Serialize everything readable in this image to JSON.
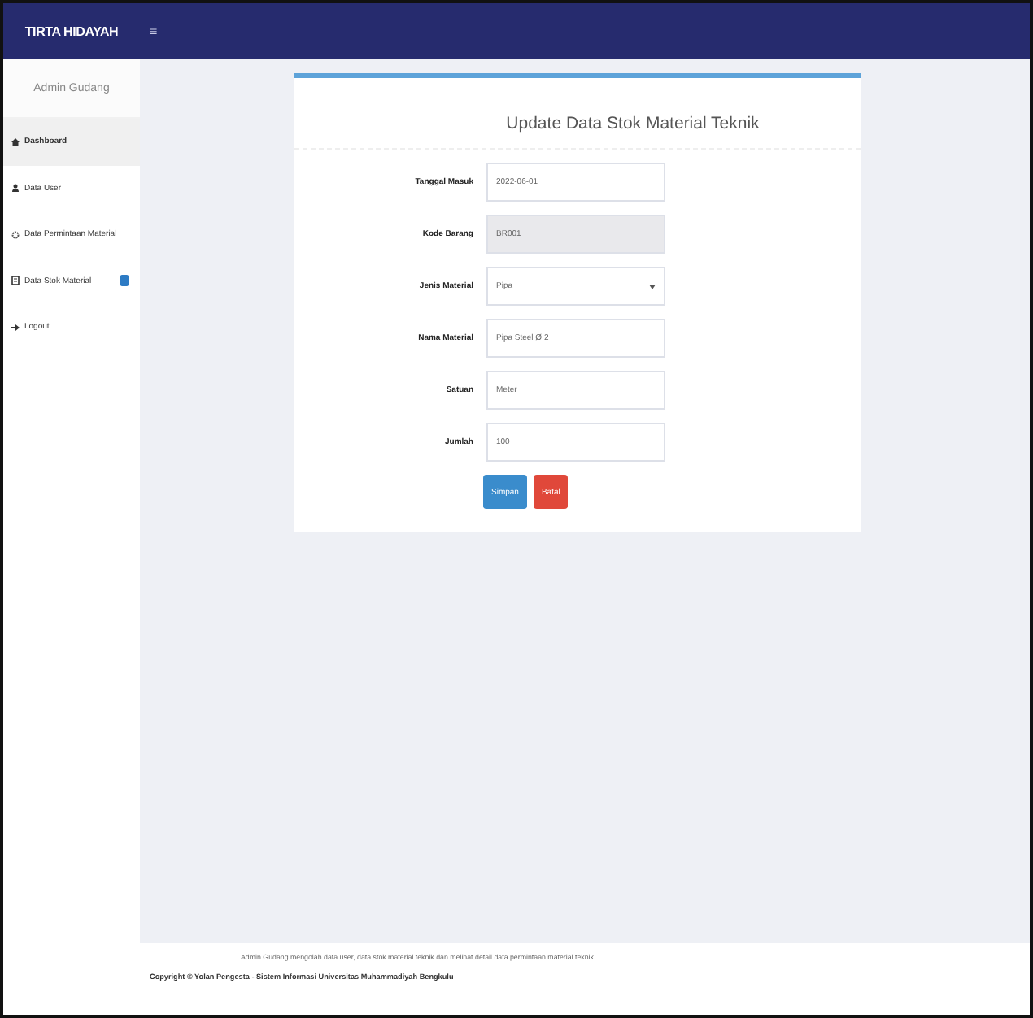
{
  "header": {
    "brand": "TIRTA HIDAYAH",
    "menu_toggle": "≡"
  },
  "sidebar": {
    "role": "Admin Gudang",
    "items": [
      {
        "label": "Dashboard",
        "kind": "home",
        "selected": true,
        "badge": false
      },
      {
        "label": "Data User",
        "kind": "user",
        "selected": false,
        "badge": false
      },
      {
        "label": "Data Permintaan Material",
        "kind": "gear",
        "selected": false,
        "badge": false
      },
      {
        "label": "Data Stok Material",
        "kind": "box",
        "selected": false,
        "badge": true
      },
      {
        "label": "Logout",
        "kind": "logout",
        "selected": false,
        "badge": false
      }
    ]
  },
  "form": {
    "title": "Update Data Stok Material Teknik",
    "fields": [
      {
        "label": "Tanggal Masuk",
        "kind": "text",
        "value": "2022-06-01",
        "disabled": false
      },
      {
        "label": "Kode Barang",
        "kind": "text",
        "value": "BR001",
        "disabled": true
      },
      {
        "label": "Jenis Material",
        "kind": "select",
        "value": "Pipa",
        "disabled": false
      },
      {
        "label": "Nama Material",
        "kind": "text",
        "value": "Pipa Steel Ø 2",
        "disabled": false
      },
      {
        "label": "Satuan",
        "kind": "text",
        "value": "Meter",
        "disabled": false
      },
      {
        "label": "Jumlah",
        "kind": "text",
        "value": "100",
        "disabled": false
      }
    ],
    "buttons": [
      {
        "label": "Simpan",
        "kind": "primary"
      },
      {
        "label": "Batal",
        "kind": "danger"
      }
    ]
  },
  "footer": {
    "note": "Admin Gudang mengolah data user, data stok material teknik dan melihat detail data permintaan material teknik.",
    "copyright": "Copyright © Yolan Pengesta - Sistem Informasi Universitas Muhammadiyah Bengkulu"
  }
}
